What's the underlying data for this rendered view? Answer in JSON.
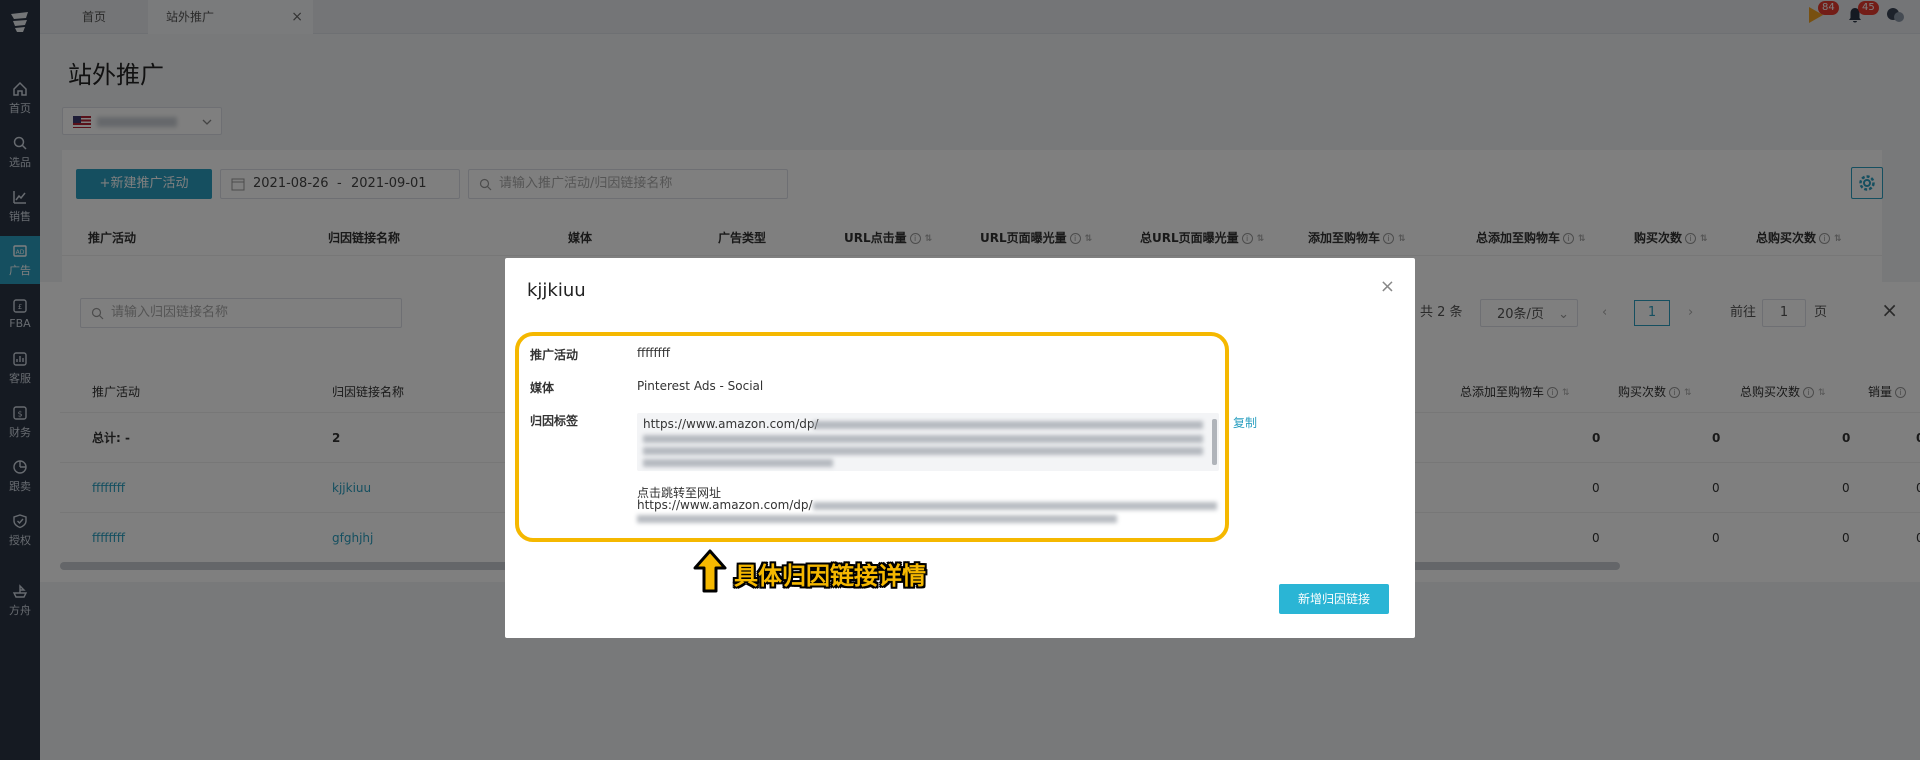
{
  "sidebar": {
    "items": [
      {
        "label": "首页",
        "icon": "home-icon"
      },
      {
        "label": "选品",
        "icon": "search-icon"
      },
      {
        "label": "销售",
        "icon": "chart-icon"
      },
      {
        "label": "广告",
        "icon": "ad-icon"
      },
      {
        "label": "FBA",
        "icon": "fba-icon"
      },
      {
        "label": "客服",
        "icon": "service-icon"
      },
      {
        "label": "财务",
        "icon": "finance-icon"
      },
      {
        "label": "跟卖",
        "icon": "pie-icon"
      },
      {
        "label": "授权",
        "icon": "shield-icon"
      },
      {
        "label": "方舟",
        "icon": "ark-icon"
      }
    ]
  },
  "tabs": [
    {
      "label": "首页"
    },
    {
      "label": "站外推广"
    }
  ],
  "tab_close": "×",
  "badges": {
    "play": "84",
    "bell": "45"
  },
  "page_title": "站外推广",
  "toolbar": {
    "new_campaign": "+新建推广活动",
    "date_start": "2021-08-26",
    "date_sep": "-",
    "date_end": "2021-09-01",
    "search_placeholder": "请输入推广活动/归因链接名称"
  },
  "table_headers": [
    "推广活动",
    "归因链接名称",
    "媒体",
    "广告类型",
    "URL点击量",
    "URL页面曝光量",
    "总URL页面曝光量",
    "添加至购物车",
    "总添加至购物车",
    "购买次数",
    "总购买次数"
  ],
  "drawer": {
    "search_placeholder": "请输入归因链接名称",
    "pager": {
      "total": "共 2 条",
      "size": "20条/页",
      "current": "1",
      "goto": "前往",
      "goto_val": "1",
      "page_unit": "页"
    },
    "close": "×",
    "headers": [
      "推广活动",
      "归因链接名称",
      "总添加至购物车",
      "购买次数",
      "总购买次数",
      "销量"
    ],
    "summary": {
      "label": "总计: -",
      "count": "2",
      "v1": "0",
      "v2": "0",
      "v3": "0",
      "v4": "0"
    },
    "rows": [
      {
        "campaign": "ffffffff",
        "link": "kjjkiuu",
        "v1": "0",
        "v2": "0",
        "v3": "0",
        "v4": "0"
      },
      {
        "campaign": "ffffffff",
        "link": "gfghjhj",
        "v1": "0",
        "v2": "0",
        "v3": "0",
        "v4": "0"
      }
    ]
  },
  "modal": {
    "title": "kjjkiuu",
    "close": "×",
    "campaign_label": "推广活动",
    "campaign_value": "ffffffff",
    "media_label": "媒体",
    "media_value": "Pinterest Ads - Social",
    "tag_label": "归因标签",
    "tag_url": "https://www.amazon.com/dp/",
    "copy": "复制",
    "jump_label": "点击跳转至网址",
    "jump_url": "https://www.amazon.com/dp/",
    "add_button": "新增归因链接"
  },
  "callout": "具体归因链接详情",
  "colors": {
    "accent": "#2a9fc0",
    "highlight": "#f5b800",
    "sidebar": "#2b3545"
  }
}
